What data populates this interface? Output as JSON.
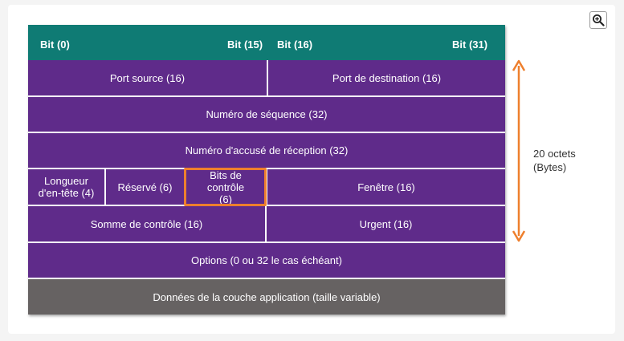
{
  "header": {
    "bit0": "Bit (0)",
    "bit15": "Bit (15)",
    "bit16": "Bit (16)",
    "bit31": "Bit (31)"
  },
  "fields": {
    "port_source": "Port source (16)",
    "port_destination": "Port de destination (16)",
    "sequence_number": "Numéro de séquence (32)",
    "ack_number": "Numéro d'accusé de réception (32)",
    "header_length": "Longueur d'en-tête (4)",
    "reserved": "Réservé (6)",
    "control_bits": "Bits de contrôle (6)",
    "window": "Fenêtre (16)",
    "checksum": "Somme de contrôle (16)",
    "urgent": "Urgent (16)",
    "options": "Options (0 ou 32 le cas échéant)",
    "app_data": "Données de la couche application (taille variable)"
  },
  "size_label": "20 octets (Bytes)",
  "icons": {
    "zoom": "zoom-in-icon",
    "arrow": "double-arrow-icon"
  },
  "colors": {
    "field_purple": "#5f2b8a",
    "header_teal": "#0f7b74",
    "data_gray": "#666262",
    "highlight_orange": "#ee7f2d"
  }
}
